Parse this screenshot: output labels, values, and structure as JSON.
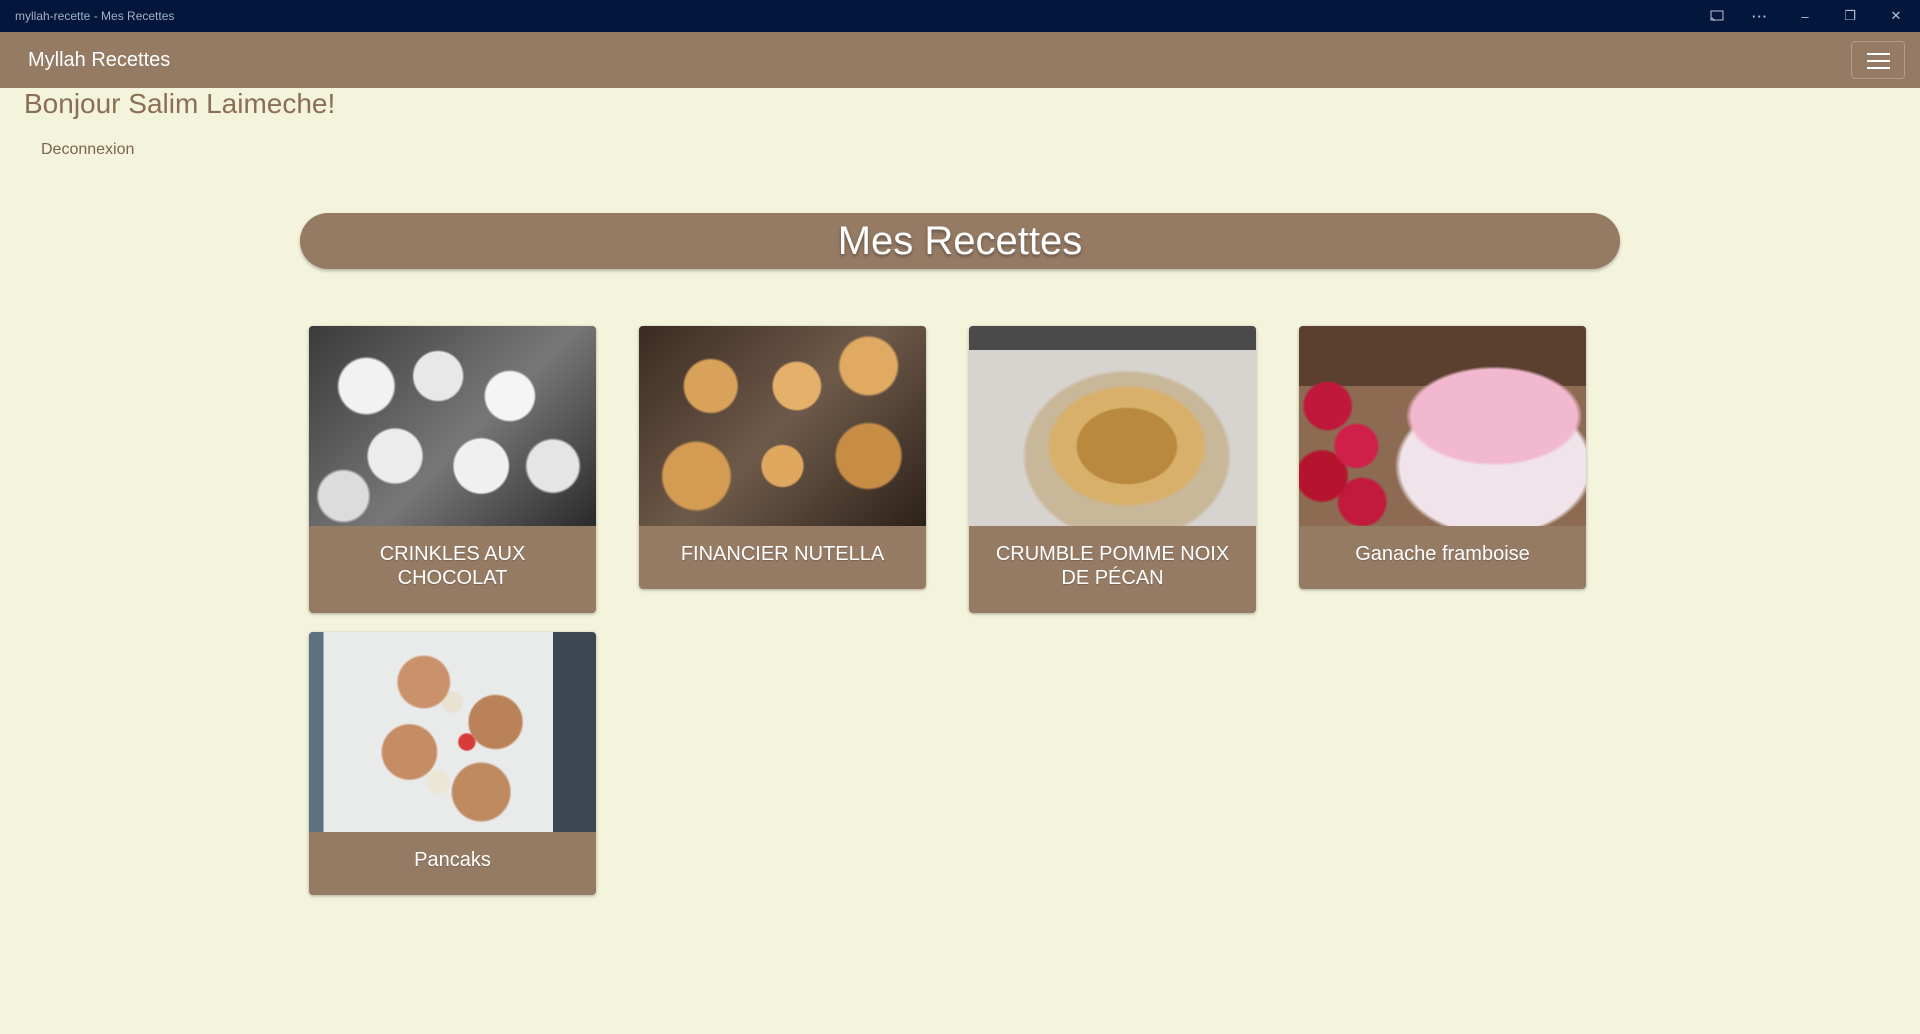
{
  "window": {
    "title": "myllah-recette - Mes Recettes",
    "controls": {
      "cast_icon": "cast-icon",
      "more_label": "···",
      "minimize_label": "–",
      "restore_label": "❐",
      "close_label": "✕"
    }
  },
  "navbar": {
    "brand": "Myllah Recettes",
    "menu_icon": "hamburger-menu-icon"
  },
  "user": {
    "greeting": "Bonjour Salim Laimeche!",
    "logout": "Deconnexion"
  },
  "page": {
    "title": "Mes Recettes"
  },
  "recipes": [
    {
      "name": "CRINKLES AUX CHOCOLAT",
      "image": "crinkles-photo"
    },
    {
      "name": "FINANCIER NUTELLA",
      "image": "financier-photo"
    },
    {
      "name": "CRUMBLE POMME NOIX DE PÉCAN",
      "image": "crumble-photo"
    },
    {
      "name": "Ganache framboise",
      "image": "ganache-photo"
    },
    {
      "name": "Pancaks",
      "image": "pancake-photo"
    }
  ],
  "colors": {
    "window_titlebar": "#03173d",
    "navbar": "#957b64",
    "background": "#f4f3dc",
    "greeting_text": "#8a6f56",
    "card": "#957b64"
  }
}
